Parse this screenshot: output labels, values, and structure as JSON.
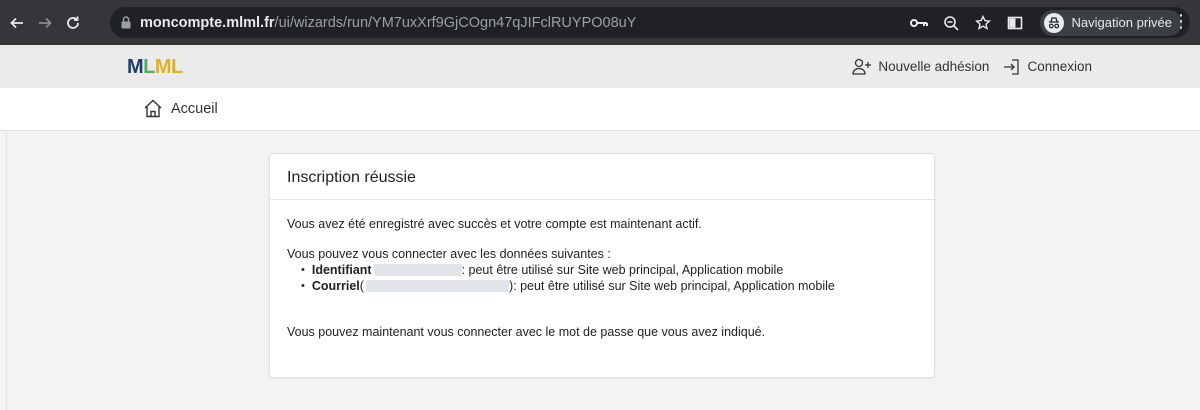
{
  "browser": {
    "url_host": "moncompte.mlml.fr",
    "url_path": "/ui/wizards/run/YM7uxXrf9GjCOgn47qJIFclRUYPO08uY",
    "incognito_label": "Navigation privée",
    "icons": [
      "back-icon",
      "forward-icon",
      "reload-icon",
      "lock-icon",
      "key-icon",
      "zoom-icon",
      "star-icon",
      "sidepanel-icon",
      "incognito-icon",
      "menu-icon"
    ]
  },
  "header": {
    "logo_parts": [
      "M",
      "L",
      "ML"
    ],
    "logo_colors": [
      "#1b3e6e",
      "#4fae58",
      "#e2b21e"
    ],
    "links": {
      "signup": "Nouvelle adhésion",
      "login": "Connexion"
    }
  },
  "breadcrumb": {
    "home_label": "Accueil"
  },
  "card": {
    "title": "Inscription réussie",
    "success_message": "Vous avez été enregistré avec succès et votre compte est maintenant actif.",
    "intro": "Vous pouvez vous connecter avec les données suivantes :",
    "credentials": [
      {
        "term": "Identifiant",
        "open": "",
        "close": ": peut être utilisé sur Site web principal, Application mobile"
      },
      {
        "term": "Courriel",
        "open": " (",
        "close": "): peut être utilisé sur Site web principal, Application mobile"
      }
    ],
    "final_message": "Vous pouvez maintenant vous connecter avec le mot de passe que vous avez indiqué."
  }
}
